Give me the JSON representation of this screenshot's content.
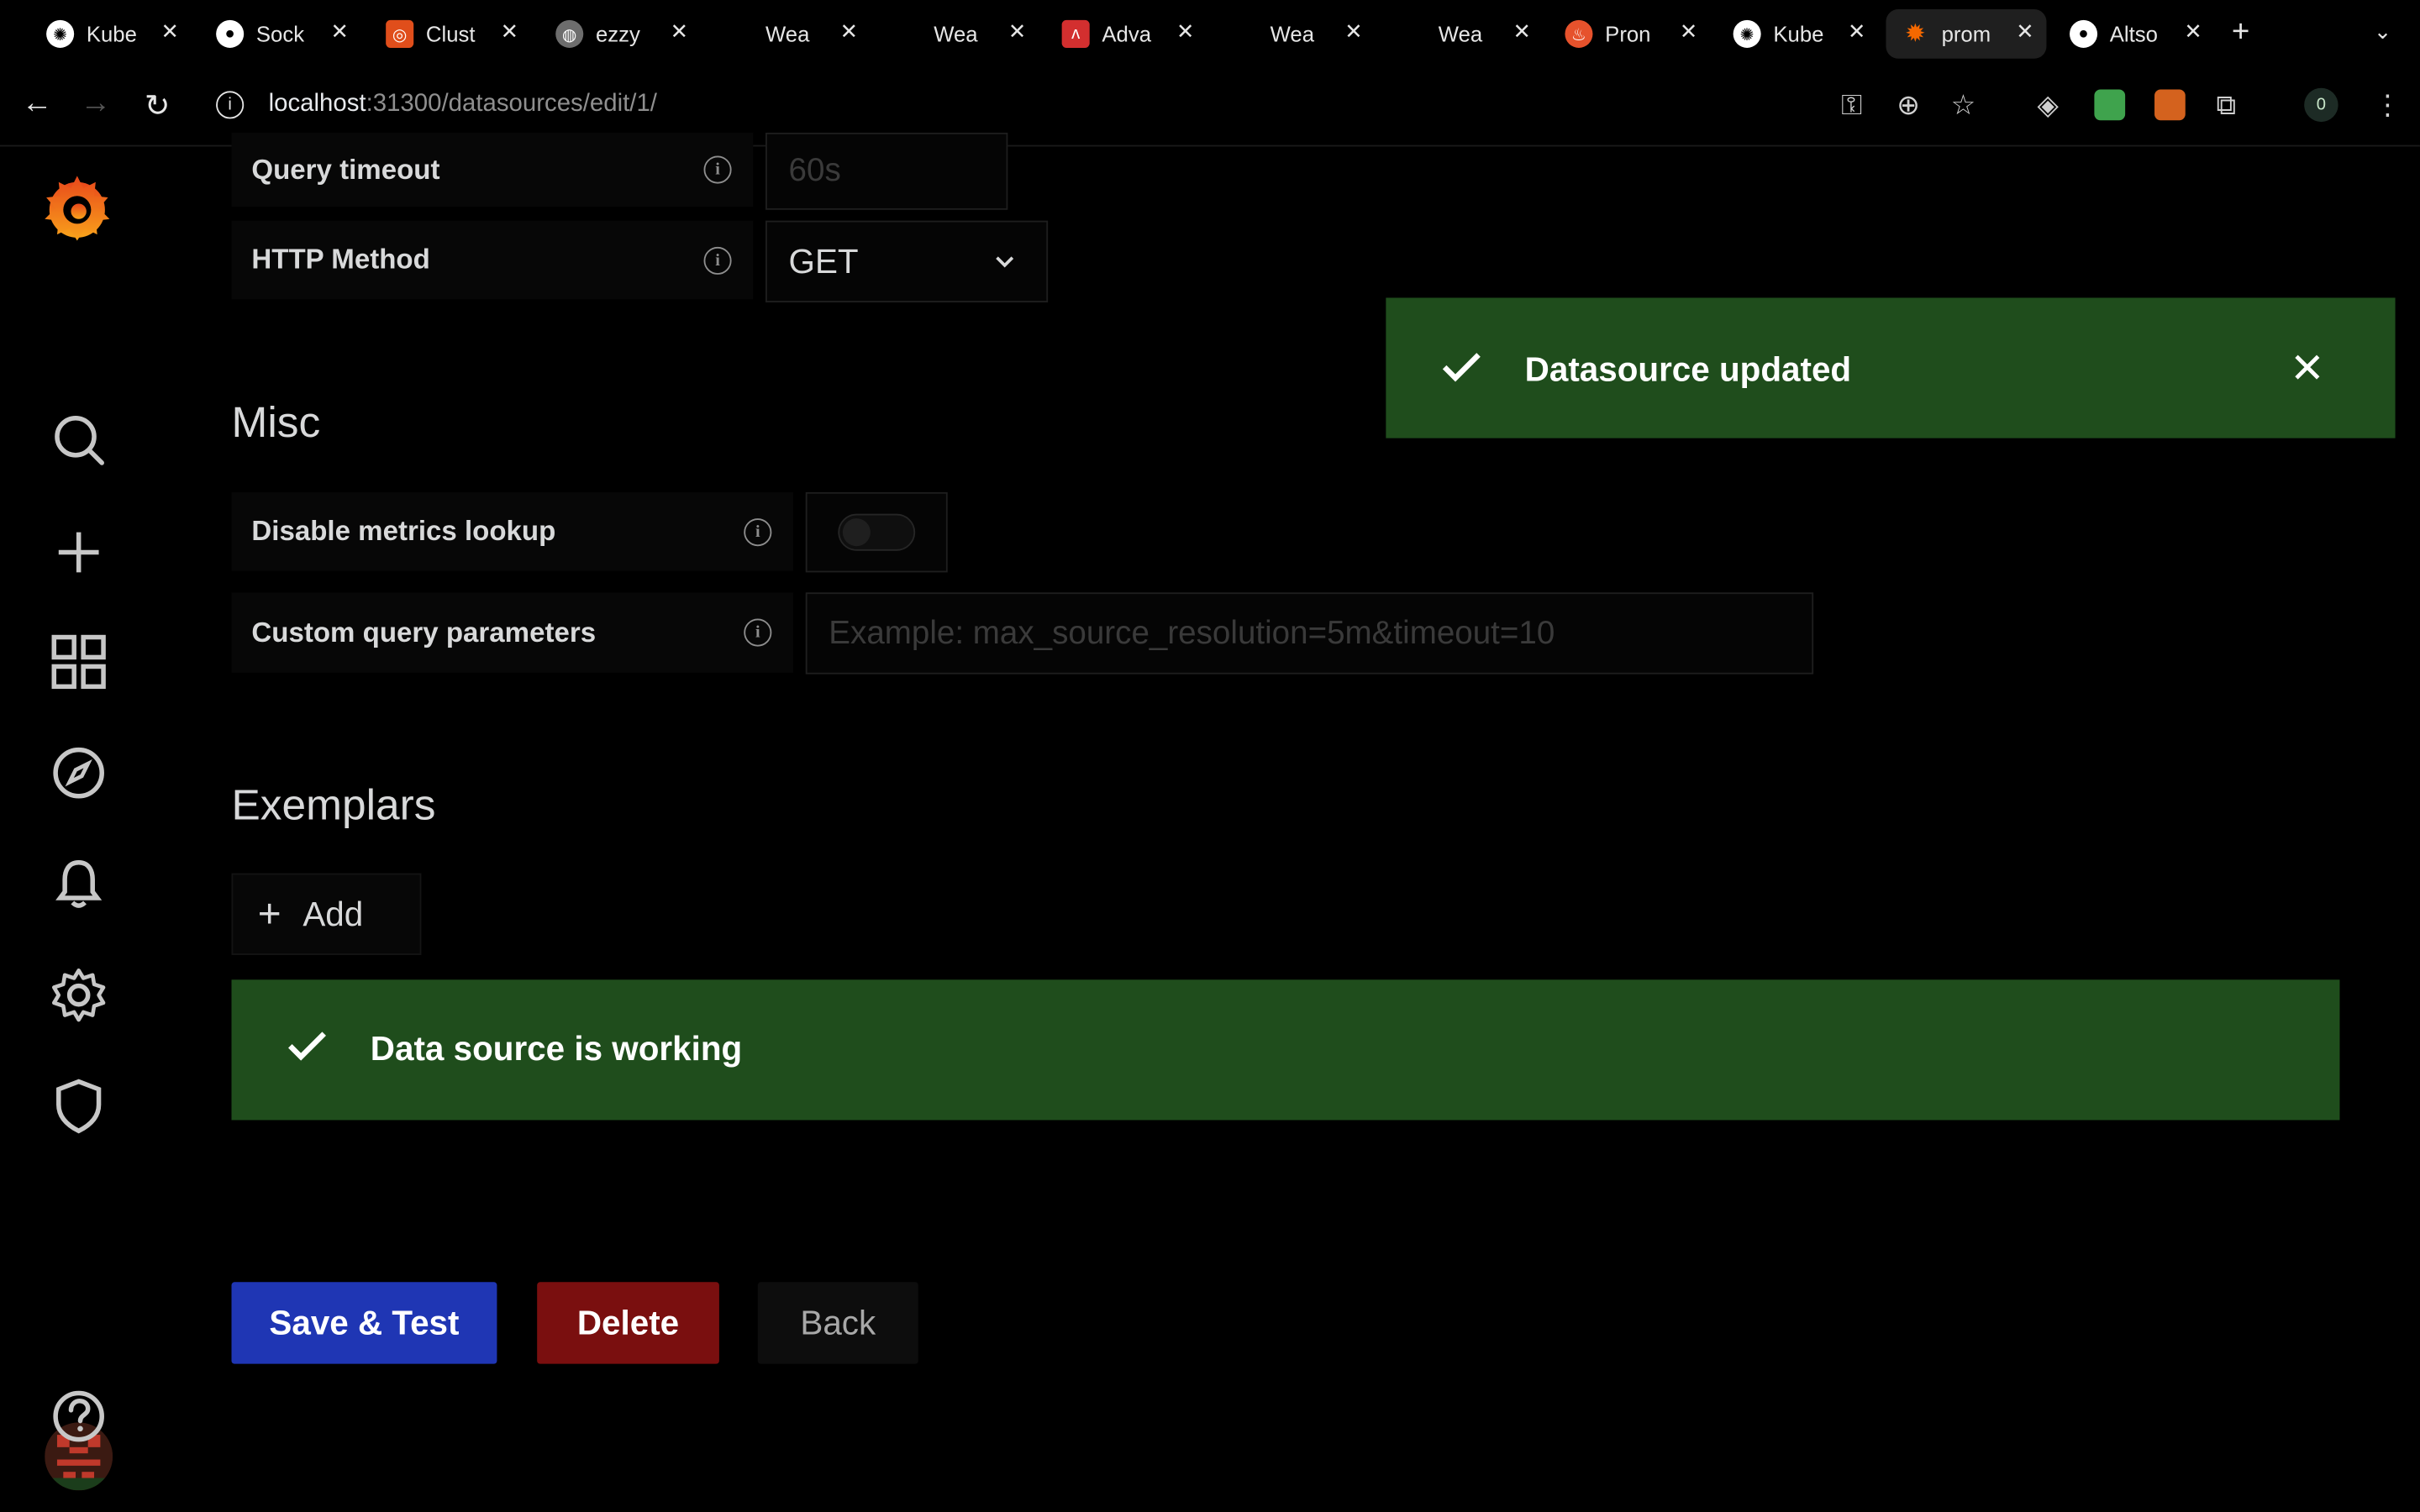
{
  "browser": {
    "tabs": [
      {
        "title": "Kube",
        "icon": "openai-icon",
        "color": "#ffffff"
      },
      {
        "title": "Sock",
        "icon": "github-icon",
        "color": "#ffffff"
      },
      {
        "title": "Clust",
        "icon": "grafana-orange-icon",
        "color": "#e04e1b"
      },
      {
        "title": "ezzy",
        "icon": "globe-icon",
        "color": "#9e9e9e"
      },
      {
        "title": "Wea",
        "icon": "",
        "color": ""
      },
      {
        "title": "Wea",
        "icon": "",
        "color": ""
      },
      {
        "title": "Adva",
        "icon": "red-app-icon",
        "color": "#d32f2f"
      },
      {
        "title": "Wea",
        "icon": "",
        "color": ""
      },
      {
        "title": "Wea",
        "icon": "",
        "color": ""
      },
      {
        "title": "Pron",
        "icon": "prometheus-icon",
        "color": "#e6522c"
      },
      {
        "title": "Kube",
        "icon": "openai-icon",
        "color": "#ffffff"
      },
      {
        "title": "prom",
        "icon": "grafana-icon",
        "color": "#f46800"
      },
      {
        "title": "Altso",
        "icon": "github-icon",
        "color": "#ffffff"
      }
    ],
    "url_host": "localhost",
    "url_path": ":31300/datasources/edit/1/",
    "profile_badge": "0"
  },
  "form": {
    "query_timeout_label": "Query timeout",
    "query_timeout_placeholder": "60s",
    "http_method_label": "HTTP Method",
    "http_method_value": "GET",
    "misc_title": "Misc",
    "disable_metrics_label": "Disable metrics lookup",
    "disable_metrics_enabled": false,
    "custom_params_label": "Custom query parameters",
    "custom_params_placeholder": "Example: max_source_resolution=5m&timeout=10",
    "exemplars_title": "Exemplars",
    "add_label": "Add"
  },
  "toast": {
    "message": "Datasource updated"
  },
  "status": {
    "message": "Data source is working"
  },
  "buttons": {
    "save": "Save & Test",
    "delete": "Delete",
    "back": "Back"
  },
  "colors": {
    "success": "#1f4d1c",
    "primary": "#1f36b4",
    "danger": "#7a0f0f"
  }
}
